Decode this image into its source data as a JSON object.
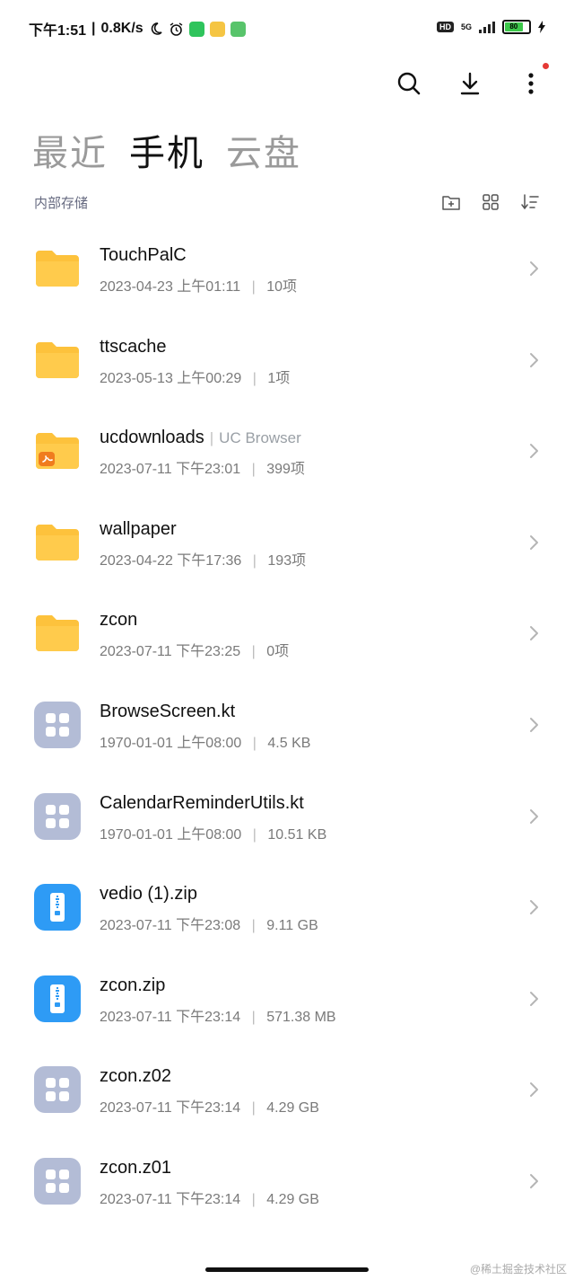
{
  "status_bar": {
    "time": "下午1:51",
    "speed": "0.8K/s",
    "network": "5G",
    "hd": "HD",
    "battery": "80"
  },
  "tabs": [
    {
      "label": "最近",
      "active": false
    },
    {
      "label": "手机",
      "active": true
    },
    {
      "label": "云盘",
      "active": false
    }
  ],
  "storage_label": "内部存储",
  "files": [
    {
      "name": "TouchPalC",
      "tag": "",
      "date": "2023-04-23 上午01:11",
      "info": "10项",
      "icon": "folder-icon"
    },
    {
      "name": "ttscache",
      "tag": "",
      "date": "2023-05-13 上午00:29",
      "info": "1项",
      "icon": "folder-icon"
    },
    {
      "name": "ucdownloads",
      "tag": "UC Browser",
      "date": "2023-07-11 下午23:01",
      "info": "399项",
      "icon": "uc-folder-icon"
    },
    {
      "name": "wallpaper",
      "tag": "",
      "date": "2023-04-22 下午17:36",
      "info": "193项",
      "icon": "folder-icon"
    },
    {
      "name": "zcon",
      "tag": "",
      "date": "2023-07-11 下午23:25",
      "info": "0项",
      "icon": "folder-icon"
    },
    {
      "name": "BrowseScreen.kt",
      "tag": "",
      "date": "1970-01-01 上午08:00",
      "info": "4.5 KB",
      "icon": "unknown-file-icon"
    },
    {
      "name": "CalendarReminderUtils.kt",
      "tag": "",
      "date": "1970-01-01 上午08:00",
      "info": "10.51 KB",
      "icon": "unknown-file-icon"
    },
    {
      "name": "vedio (1).zip",
      "tag": "",
      "date": "2023-07-11 下午23:08",
      "info": "9.11 GB",
      "icon": "zip-file-icon"
    },
    {
      "name": "zcon.zip",
      "tag": "",
      "date": "2023-07-11 下午23:14",
      "info": "571.38 MB",
      "icon": "zip-file-icon"
    },
    {
      "name": "zcon.z02",
      "tag": "",
      "date": "2023-07-11 下午23:14",
      "info": "4.29 GB",
      "icon": "unknown-file-icon"
    },
    {
      "name": "zcon.z01",
      "tag": "",
      "date": "2023-07-11 下午23:14",
      "info": "4.29 GB",
      "icon": "unknown-file-icon"
    }
  ],
  "watermark": "@稀土掘金技术社区",
  "colors": {
    "folder": "#FDC23C",
    "zip": "#2E9BF5",
    "unknown": "#B3BCD6",
    "accent_dot": "#E53935"
  }
}
